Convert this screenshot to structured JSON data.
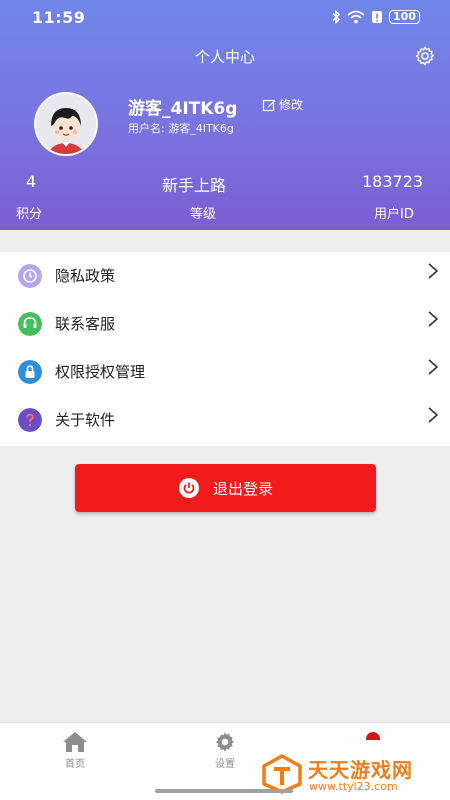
{
  "status_bar": {
    "time": "11:59",
    "battery": "100"
  },
  "header": {
    "title": "个人中心"
  },
  "profile": {
    "display_name": "游客_4ITK6g",
    "edit_label": "修改",
    "username_line": "用户名: 游客_4ITK6g"
  },
  "stats": [
    {
      "value": "4",
      "label": "积分"
    },
    {
      "value": "新手上路",
      "label": "等级"
    },
    {
      "value": "183723",
      "label": "用户ID"
    }
  ],
  "menu": [
    {
      "label": "隐私政策",
      "icon": "privacy-icon",
      "color": "#b6a4ee"
    },
    {
      "label": "联系客服",
      "icon": "customer-service-icon",
      "color": "#44bf5c"
    },
    {
      "label": "权限授权管理",
      "icon": "lock-icon",
      "color": "#2b8fe0"
    },
    {
      "label": "关于软件",
      "icon": "question-icon",
      "color": "#6a4fc4"
    }
  ],
  "logout": {
    "label": "退出登录"
  },
  "tabs": [
    {
      "label": "首页",
      "icon": "home-icon"
    },
    {
      "label": "设置",
      "icon": "gear-icon"
    }
  ],
  "watermark": {
    "title": "天天游戏网",
    "url": "www.ttyl23.com"
  },
  "colors": {
    "header_top": "#6f86ea",
    "header_bottom": "#7b5ed2",
    "logout": "#f21a1a",
    "watermark": "#ef7d1a"
  }
}
